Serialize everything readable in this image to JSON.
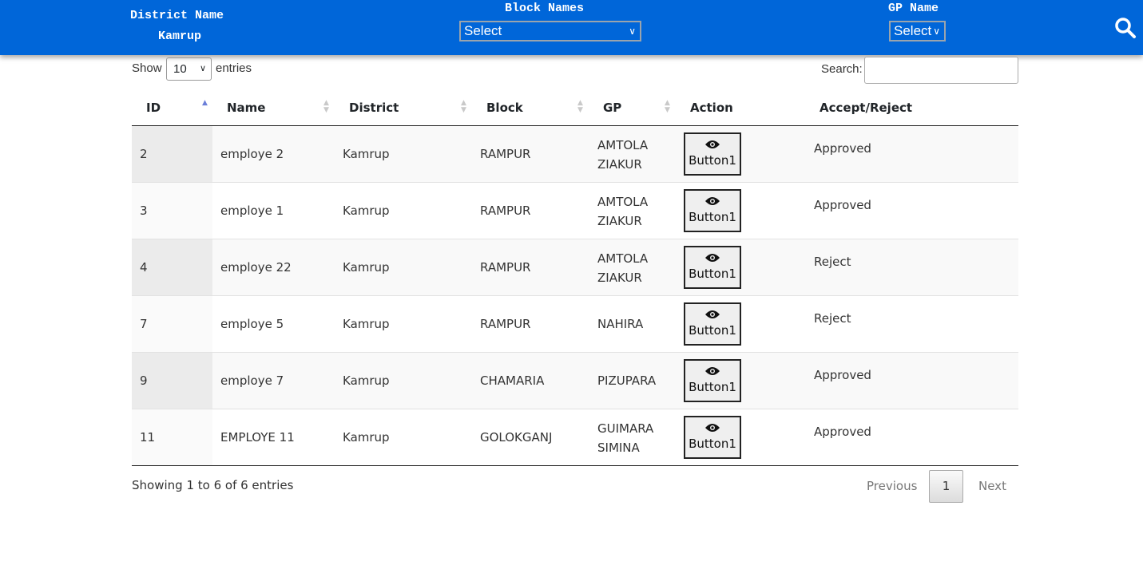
{
  "header": {
    "district_label": "District Name",
    "district_value": "Kamrup",
    "block_label": "Block Names",
    "block_select_value": "Select",
    "gp_label": "GP Name",
    "gp_select_value": "Select",
    "search_icon": "search-icon",
    "bar_color": "#0066d9"
  },
  "controls": {
    "show_label": "Show",
    "page_length": "10",
    "entries_label": "entries",
    "search_label": "Search:",
    "search_value": ""
  },
  "table": {
    "columns": [
      "ID",
      "Name",
      "District",
      "Block",
      "GP",
      "Action",
      "Accept/Reject"
    ],
    "rows": [
      {
        "id": "2",
        "name": "employe 2",
        "district": "Kamrup",
        "block": "RAMPUR",
        "gp": [
          "AMTOLA",
          "ZIAKUR"
        ],
        "action": "Button1",
        "status": "Approved"
      },
      {
        "id": "3",
        "name": "employe 1",
        "district": "Kamrup",
        "block": "RAMPUR",
        "gp": [
          "AMTOLA",
          "ZIAKUR"
        ],
        "action": "Button1",
        "status": "Approved"
      },
      {
        "id": "4",
        "name": "employe 22",
        "district": "Kamrup",
        "block": "RAMPUR",
        "gp": [
          "AMTOLA",
          "ZIAKUR"
        ],
        "action": "Button1",
        "status": "Reject"
      },
      {
        "id": "7",
        "name": "employe 5",
        "district": "Kamrup",
        "block": "RAMPUR",
        "gp": [
          "NAHIRA"
        ],
        "action": "Button1",
        "status": "Reject"
      },
      {
        "id": "9",
        "name": "employe 7",
        "district": "Kamrup",
        "block": "CHAMARIA",
        "gp": [
          "PIZUPARA"
        ],
        "action": "Button1",
        "status": "Approved"
      },
      {
        "id": "11",
        "name": "EMPLOYE 11",
        "district": "Kamrup",
        "block": "GOLOKGANJ",
        "gp": [
          "GUIMARA",
          "SIMINA"
        ],
        "action": "Button1",
        "status": "Approved"
      }
    ]
  },
  "footer": {
    "info": "Showing 1 to 6 of 6 entries",
    "previous": "Previous",
    "current_page": "1",
    "next": "Next"
  }
}
